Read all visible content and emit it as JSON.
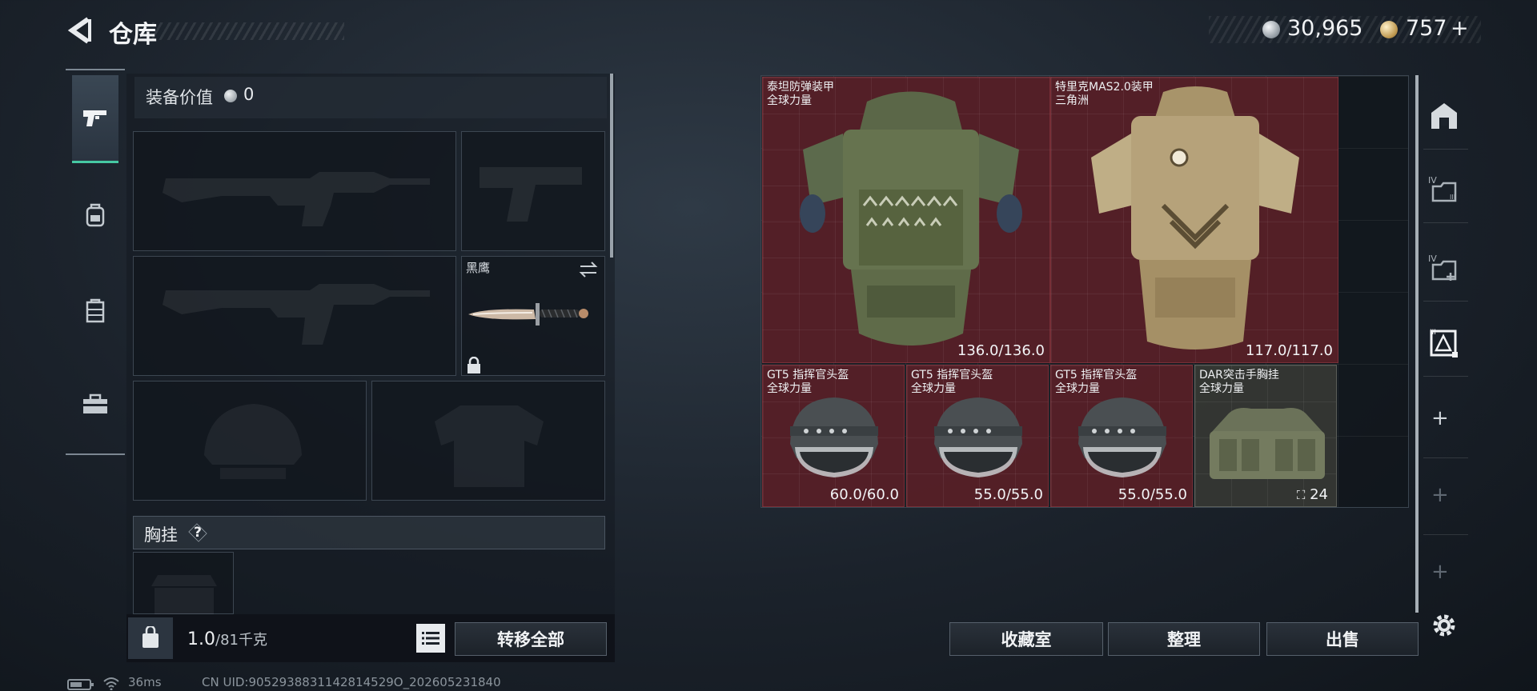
{
  "header": {
    "title": "仓库",
    "silver_amount": "30,965",
    "gold_amount": "757",
    "gold_plus": "+"
  },
  "nav": {
    "items": [
      "pistol-icon",
      "backpack-icon",
      "chest-rig-icon",
      "toolbox-icon"
    ],
    "active": "pistol-icon"
  },
  "equipment": {
    "value_label": "装备价值",
    "value": "0",
    "knife": {
      "name": "黑鹰"
    },
    "chest_rig_label": "胸挂",
    "help": "?",
    "weight_value": "1.0",
    "weight_max": "/81千克",
    "transfer_all": "转移全部"
  },
  "storage": {
    "items": [
      {
        "name": "泰坦防弹装甲",
        "source": "全球力量",
        "durability": "136.0/136.0"
      },
      {
        "name": "特里克MAS2.0装甲",
        "source": "三角洲",
        "durability": "117.0/117.0"
      },
      {
        "name": "GT5 指挥官头盔",
        "source": "全球力量",
        "durability": "60.0/60.0"
      },
      {
        "name": "GT5 指挥官头盔",
        "source": "全球力量",
        "durability": "55.0/55.0"
      },
      {
        "name": "GT5 指挥官头盔",
        "source": "全球力量",
        "durability": "55.0/55.0"
      },
      {
        "name": "DAR突击手胸挂",
        "source": "全球力量",
        "capacity": "24"
      }
    ]
  },
  "actions": {
    "collection": "收藏室",
    "sort": "整理",
    "sell": "出售"
  },
  "status": {
    "ping": "36ms",
    "uid": "CN UID:9052938831142814529O_202605231840"
  },
  "colors": {
    "accent": "#46c9a3",
    "item_red": "#5c2028",
    "panel": "#141a21"
  }
}
